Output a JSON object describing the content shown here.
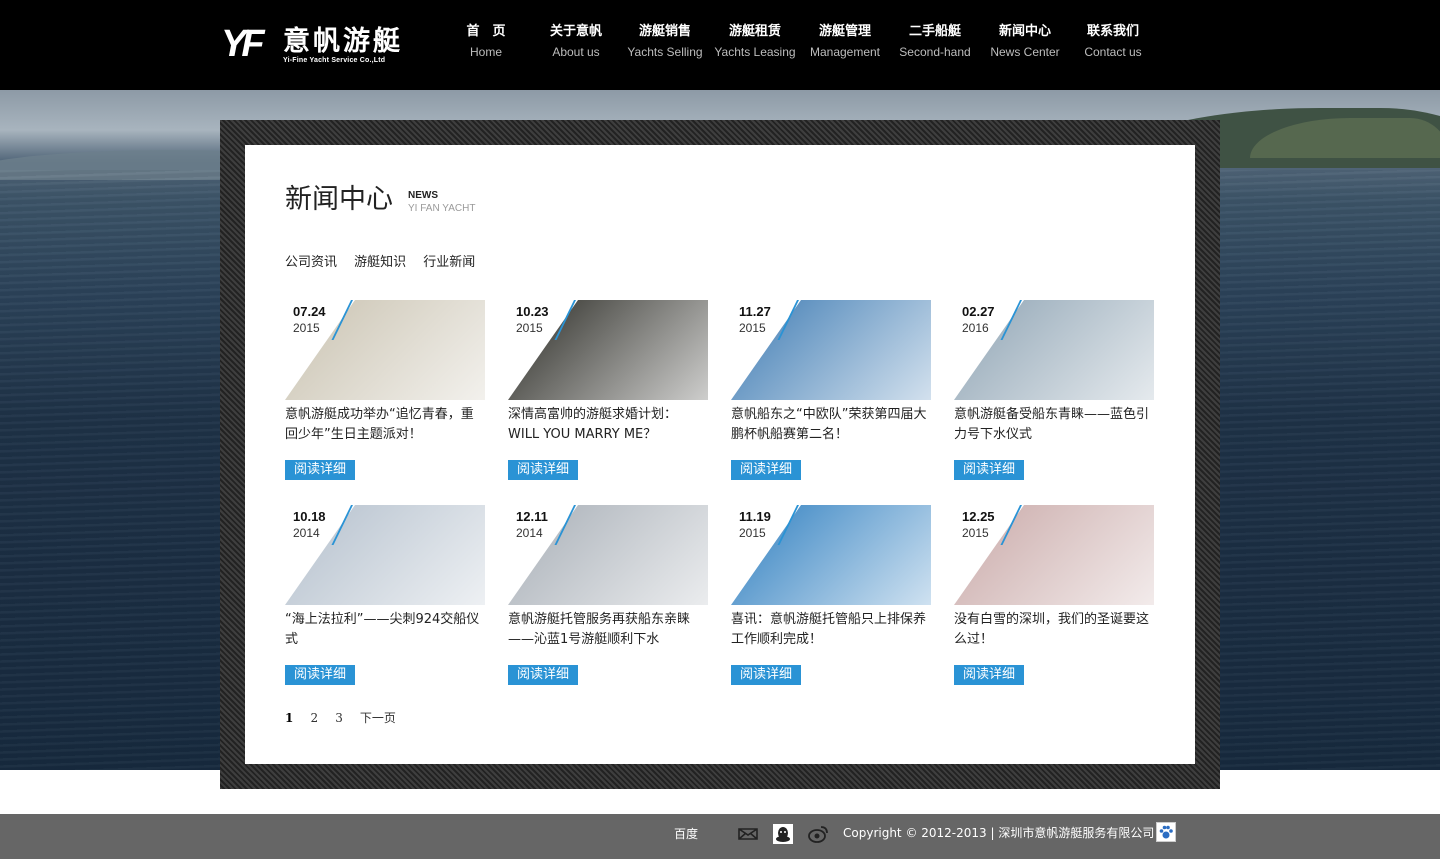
{
  "header": {
    "logo_mark": "YF",
    "logo_cn": "意帆游艇",
    "logo_en": "Yi-Fine Yacht Service Co.,Ltd",
    "nav": [
      {
        "cn": "首　页",
        "en": "Home"
      },
      {
        "cn": "关于意帆",
        "en": "About us"
      },
      {
        "cn": "游艇销售",
        "en": "Yachts Selling"
      },
      {
        "cn": "游艇租赁",
        "en": "Yachts Leasing"
      },
      {
        "cn": "游艇管理",
        "en": "Management"
      },
      {
        "cn": "二手船艇",
        "en": "Second-hand"
      },
      {
        "cn": "新闻中心",
        "en": "News Center"
      },
      {
        "cn": "联系我们",
        "en": "Contact us"
      }
    ]
  },
  "section": {
    "title_cn": "新闻中心",
    "title_en": "NEWS",
    "title_sub": "YI FAN YACHT",
    "categories": [
      "公司资讯",
      "游艇知识",
      "行业新闻"
    ]
  },
  "news": [
    {
      "md": "07.24",
      "year": "2015",
      "title": "意帆游艇成功举办“追忆青春，重回少年”生日主题派对！",
      "button": "阅读详细",
      "bg": "#c9c2b0"
    },
    {
      "md": "10.23",
      "year": "2015",
      "title": "深情高富帅的游艇求婚计划：WILL YOU MARRY ME？",
      "button": "阅读详细",
      "bg": "#2a2a24"
    },
    {
      "md": "11.27",
      "year": "2015",
      "title": "意帆船东之“中欧队”荣获第四届大鹏杯帆船赛第二名！",
      "button": "阅读详细",
      "bg": "#3e7bb3"
    },
    {
      "md": "02.27",
      "year": "2016",
      "title": "意帆游艇备受船东青睐——蓝色引力号下水仪式",
      "button": "阅读详细",
      "bg": "#8fa4b4"
    },
    {
      "md": "10.18",
      "year": "2014",
      "title": "“海上法拉利”——尖刺924交船仪式",
      "button": "阅读详细",
      "bg": "#b3bfcc"
    },
    {
      "md": "12.11",
      "year": "2014",
      "title": "意帆游艇托管服务再获船东亲睐——沁蓝1号游艇顺利下水",
      "button": "阅读详细",
      "bg": "#a7aeb6"
    },
    {
      "md": "11.19",
      "year": "2015",
      "title": "喜讯：意帆游艇托管船只上排保养工作顺利完成！",
      "button": "阅读详细",
      "bg": "#2f7fc0"
    },
    {
      "md": "12.25",
      "year": "2015",
      "title": "没有白雪的深圳，我们的圣诞要这么过！",
      "button": "阅读详细",
      "bg": "#c9a9a8"
    }
  ],
  "pager": {
    "pages": [
      "1",
      "2",
      "3"
    ],
    "next": "下一页"
  },
  "footer": {
    "baidu": "百度",
    "copyright": "Copyright © 2012-2013 | 深圳市意帆游艇服务有限公司",
    "icons": [
      "mail-icon",
      "qq-icon",
      "weibo-icon",
      "baidu-paw-icon"
    ]
  },
  "colors": {
    "accent": "#2a93d5",
    "header_bg": "#000000",
    "footer_bg": "#666666"
  }
}
